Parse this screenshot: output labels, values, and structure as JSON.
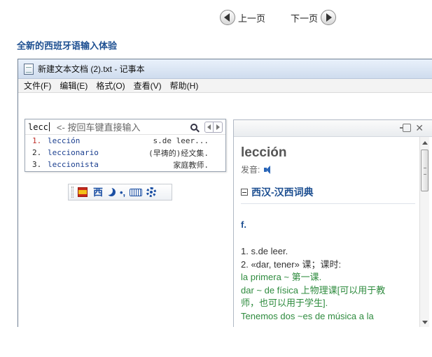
{
  "pager": {
    "prev_label": "上一页",
    "next_label": "下一页"
  },
  "headline": "全新的西班牙语输入体验",
  "window": {
    "title": "新建文本文档 (2).txt - 记事本",
    "menu": [
      "文件(F)",
      "编辑(E)",
      "格式(O)",
      "查看(V)",
      "帮助(H)"
    ]
  },
  "ime": {
    "input": "lecc",
    "hint": "<- 按回车键直接输入",
    "candidates": [
      {
        "num": "1.",
        "word": "lección",
        "def": "s.de leer..."
      },
      {
        "num": "2.",
        "word": "leccionario",
        "def": "(早祷的)经文集."
      },
      {
        "num": "3.",
        "word": "leccionista",
        "def": "家庭教师."
      }
    ]
  },
  "toolbar": {
    "mode_label": "西",
    "punct_label": "•,"
  },
  "dict": {
    "headword": "lección",
    "pron_label": "发音:",
    "section": "西汉-汉西词典",
    "pos": "f.",
    "lines": [
      {
        "text": "1. s.de leer.",
        "style": "dark"
      },
      {
        "text": "2. «dar, tener» 课；课时:",
        "style": "dark"
      },
      {
        "text": "la primera ~ 第一课.",
        "style": "green"
      },
      {
        "text": "dar ~ de física 上物理课[可以用于教",
        "style": "green"
      },
      {
        "text": "师，也可以用于学生].",
        "style": "green"
      },
      {
        "text": "Tenemos dos ~es de música a la",
        "style": "green"
      }
    ]
  },
  "colors": {
    "accent": "#1d4f91",
    "example": "#2e8b3e",
    "candidate_first": "#c0302a"
  }
}
